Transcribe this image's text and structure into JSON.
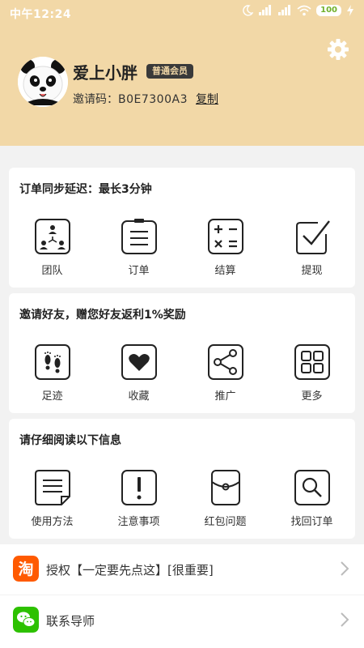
{
  "status_bar": {
    "time": "中午12:24",
    "battery": "100"
  },
  "profile": {
    "username": "爱上小胖",
    "member_badge": "普通会员",
    "invite_label": "邀请码：",
    "invite_code": "B0E7300A3",
    "copy_label": "复制"
  },
  "section_orders": {
    "title": "订单同步延迟：最长3分钟",
    "items": [
      {
        "label": "团队",
        "icon": "team-icon"
      },
      {
        "label": "订单",
        "icon": "order-icon"
      },
      {
        "label": "结算",
        "icon": "calculator-icon"
      },
      {
        "label": "提现",
        "icon": "withdraw-check-icon"
      }
    ]
  },
  "section_invite": {
    "title": "邀请好友，赠您好友返利1%奖励",
    "items": [
      {
        "label": "足迹",
        "icon": "footprints-icon"
      },
      {
        "label": "收藏",
        "icon": "heart-icon"
      },
      {
        "label": "推广",
        "icon": "share-icon"
      },
      {
        "label": "更多",
        "icon": "grid-more-icon"
      }
    ]
  },
  "section_info": {
    "title": "请仔细阅读以下信息",
    "items": [
      {
        "label": "使用方法",
        "icon": "document-icon"
      },
      {
        "label": "注意事项",
        "icon": "exclamation-icon"
      },
      {
        "label": "红包问题",
        "icon": "red-envelope-icon"
      },
      {
        "label": "找回订单",
        "icon": "search-icon"
      }
    ]
  },
  "list_rows": [
    {
      "label": "授权【一定要先点这】[很重要]",
      "icon": "taobao-icon",
      "icon_color": "#ff5a00"
    },
    {
      "label": "联系导师",
      "icon": "wechat-icon",
      "icon_color": "#2dc100"
    }
  ],
  "colors": {
    "header_bg": "#f2d8a7",
    "badge_bg": "#3a3a3a",
    "badge_text": "#f2d8a7"
  }
}
